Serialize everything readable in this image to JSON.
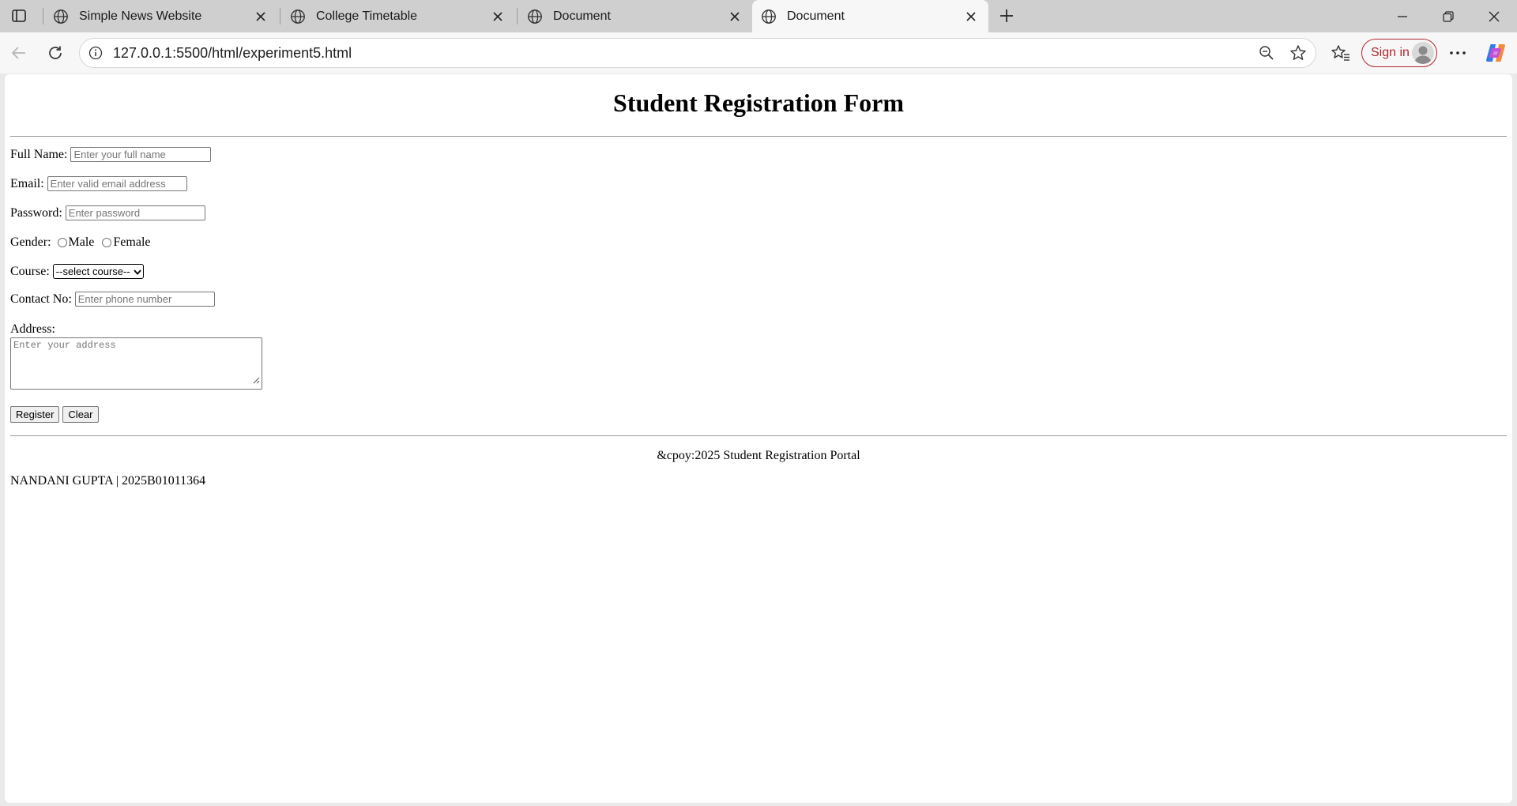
{
  "browser": {
    "tabs": [
      {
        "title": "Simple News Website"
      },
      {
        "title": "College Timetable"
      },
      {
        "title": "Document"
      },
      {
        "title": "Document"
      }
    ],
    "url": "127.0.0.1:5500/html/experiment5.html",
    "sign_in_label": "Sign in"
  },
  "form": {
    "title": "Student Registration Form",
    "full_name": {
      "label": "Full Name:",
      "placeholder": "Enter your full name"
    },
    "email": {
      "label": "Email:",
      "placeholder": "Enter valid email address"
    },
    "password": {
      "label": "Password:",
      "placeholder": "Enter password"
    },
    "gender": {
      "label": "Gender:",
      "options": [
        "Male",
        "Female"
      ]
    },
    "course": {
      "label": "Course:",
      "selected": "--select course--"
    },
    "contact": {
      "label": "Contact No:",
      "placeholder": "Enter phone number"
    },
    "address": {
      "label": "Address:",
      "placeholder": "Enter your address"
    },
    "register_label": "Register",
    "clear_label": "Clear"
  },
  "footer": {
    "copyright": "&cpoy:2025 Student Registration Portal",
    "credit": "NANDANI GUPTA | 2025B01011364"
  }
}
